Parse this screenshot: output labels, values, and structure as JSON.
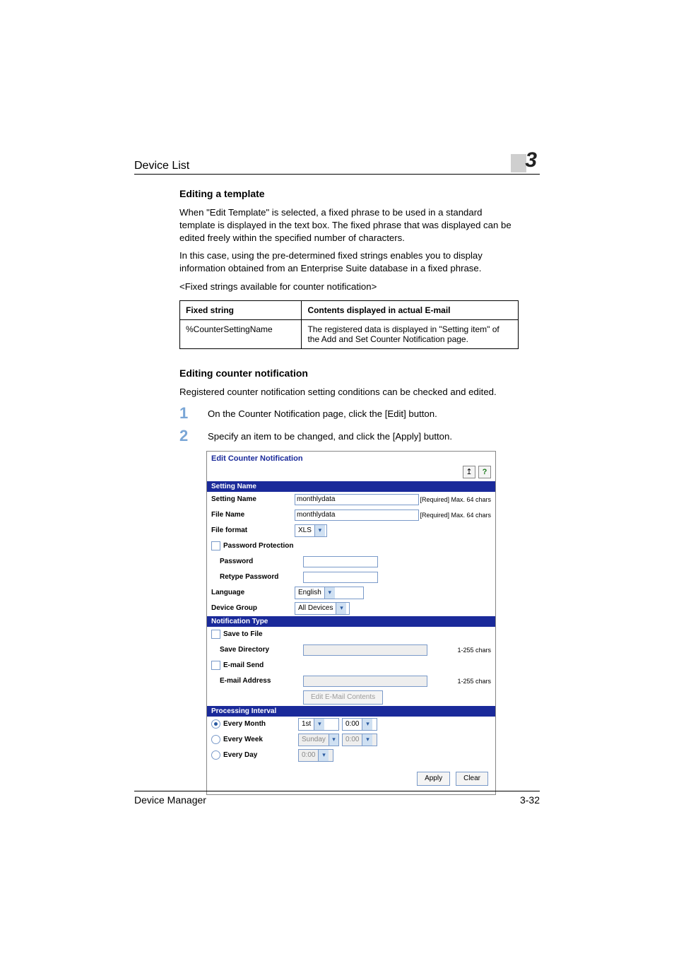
{
  "header": {
    "running_title": "Device List",
    "chapter_number": "3"
  },
  "section1": {
    "heading": "Editing a template",
    "p1": "When \"Edit Template\" is selected, a fixed phrase to be used in a standard template is displayed in the text box. The fixed phrase that was displayed can be edited freely within the specified number of characters.",
    "p2": "In this case, using the pre-determined fixed strings enables you to display information obtained from an Enterprise Suite database in a fixed phrase.",
    "p3": "<Fixed strings available for counter notification>",
    "table": {
      "h1": "Fixed string",
      "h2": "Contents displayed in actual E-mail",
      "r1c1": "%CounterSettingName",
      "r1c2": "The registered data is displayed in \"Setting item\" of the Add and Set Counter Notification page."
    }
  },
  "section2": {
    "heading": "Editing counter notification",
    "p1": "Registered counter notification setting conditions can be checked and edited.",
    "step1": "On the Counter Notification page, click the [Edit] button.",
    "step2": "Specify an item to be changed, and click the [Apply] button."
  },
  "shot": {
    "title": "Edit Counter Notification",
    "icons": {
      "back": "↥",
      "help": "?"
    },
    "sec_setting": "Setting Name",
    "setting_name_lab": "Setting Name",
    "setting_name_val": "monthlydata",
    "setting_name_note": "[Required] Max. 64 chars",
    "file_name_lab": "File Name",
    "file_name_val": "monthlydata",
    "file_name_note": "[Required] Max. 64 chars",
    "file_format_lab": "File format",
    "file_format_val": "XLS",
    "pw_protect_lab": "Password Protection",
    "pw_lab": "Password",
    "rpw_lab": "Retype Password",
    "lang_lab": "Language",
    "lang_val": "English",
    "dg_lab": "Device Group",
    "dg_val": "All Devices",
    "sec_notif": "Notification Type",
    "save_file_lab": "Save to File",
    "save_dir_lab": "Save Directory",
    "save_dir_note": "1-255 chars",
    "email_send_lab": "E-mail Send",
    "email_addr_lab": "E-mail Address",
    "email_addr_note": "1-255 chars",
    "edit_email_btn": "Edit E-Mail Contents",
    "sec_proc": "Processing Interval",
    "every_month_lab": "Every Month",
    "em_day": "1st",
    "em_time": "0:00",
    "every_week_lab": "Every Week",
    "ew_day": "Sunday",
    "ew_time": "0:00",
    "every_day_lab": "Every Day",
    "ed_time": "0:00",
    "apply_btn": "Apply",
    "clear_btn": "Clear"
  },
  "footer": {
    "product": "Device Manager",
    "page": "3-32"
  }
}
